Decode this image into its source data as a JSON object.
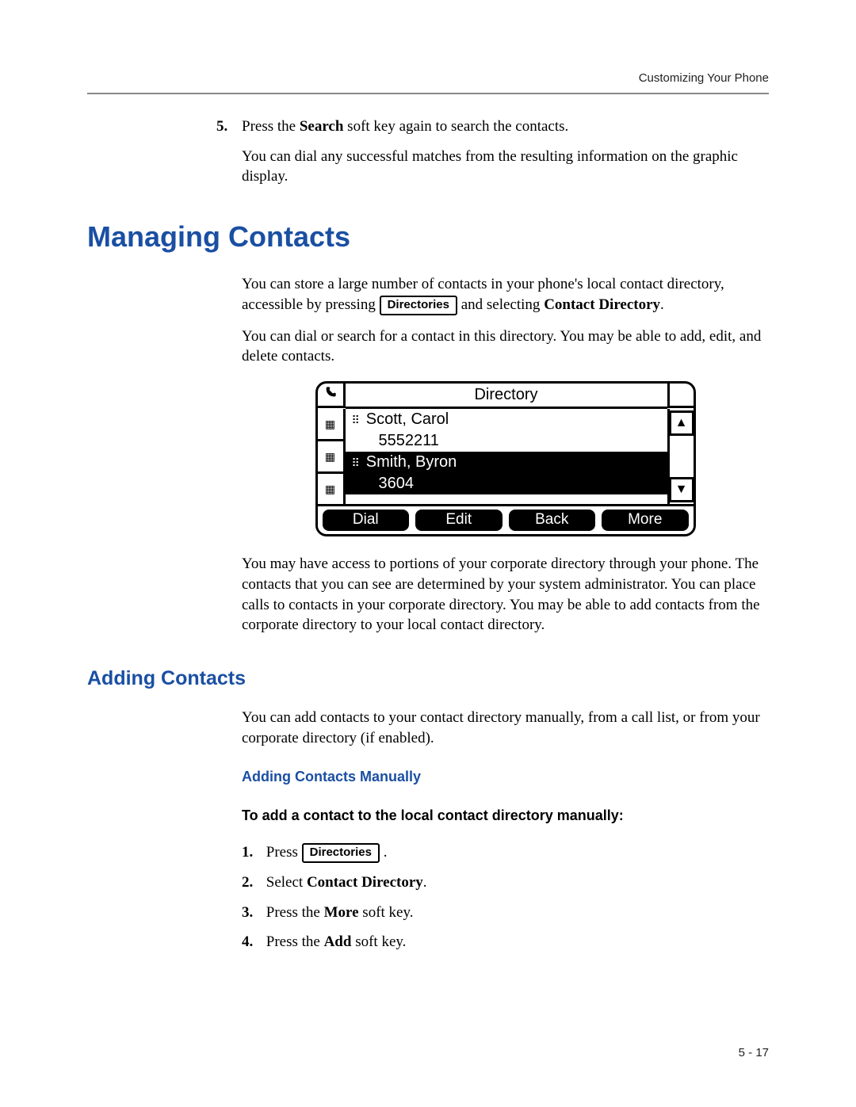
{
  "header": {
    "running": "Customizing Your Phone"
  },
  "prev_step": {
    "number": "5.",
    "text_a": "Press the ",
    "bold_a": "Search",
    "text_b": " soft key again to search the contacts.",
    "sub": "You can dial any successful matches from the resulting information on the graphic display."
  },
  "h1": "Managing Contacts",
  "para1": {
    "a": "You can store a large number of contacts in your phone's local contact directory, accessible by pressing ",
    "key": "Directories",
    "b": " and selecting ",
    "bold": "Contact Directory",
    "c": "."
  },
  "para2": "You can dial or search for a contact in this directory. You may be able to add, edit, and delete contacts.",
  "lcd": {
    "title": "Directory",
    "contacts": [
      {
        "name": "Scott, Carol",
        "number": "5552211",
        "selected": false
      },
      {
        "name": "Smith, Byron",
        "number": "3604",
        "selected": true
      }
    ],
    "softkeys": [
      "Dial",
      "Edit",
      "Back",
      "More"
    ]
  },
  "para3": "You may have access to portions of your corporate directory through your phone. The contacts that you can see are determined by your system administrator. You can place calls to contacts in your corporate directory. You may be able to add contacts from the corporate directory to your local contact directory.",
  "h2": "Adding Contacts",
  "para4": "You can add contacts to your contact directory manually, from a call list, or from your corporate directory (if enabled).",
  "h3": "Adding Contacts Manually",
  "h4": "To add a contact to the local contact directory manually:",
  "steps": [
    {
      "n": "1.",
      "pre": "Press ",
      "key": "Directories",
      "post": " ."
    },
    {
      "n": "2.",
      "pre": "Select ",
      "bold": "Contact Directory",
      "post": "."
    },
    {
      "n": "3.",
      "pre": "Press the ",
      "bold": "More",
      "post": " soft key."
    },
    {
      "n": "4.",
      "pre": "Press the ",
      "bold": "Add",
      "post": " soft key."
    }
  ],
  "footer": "5 - 17"
}
